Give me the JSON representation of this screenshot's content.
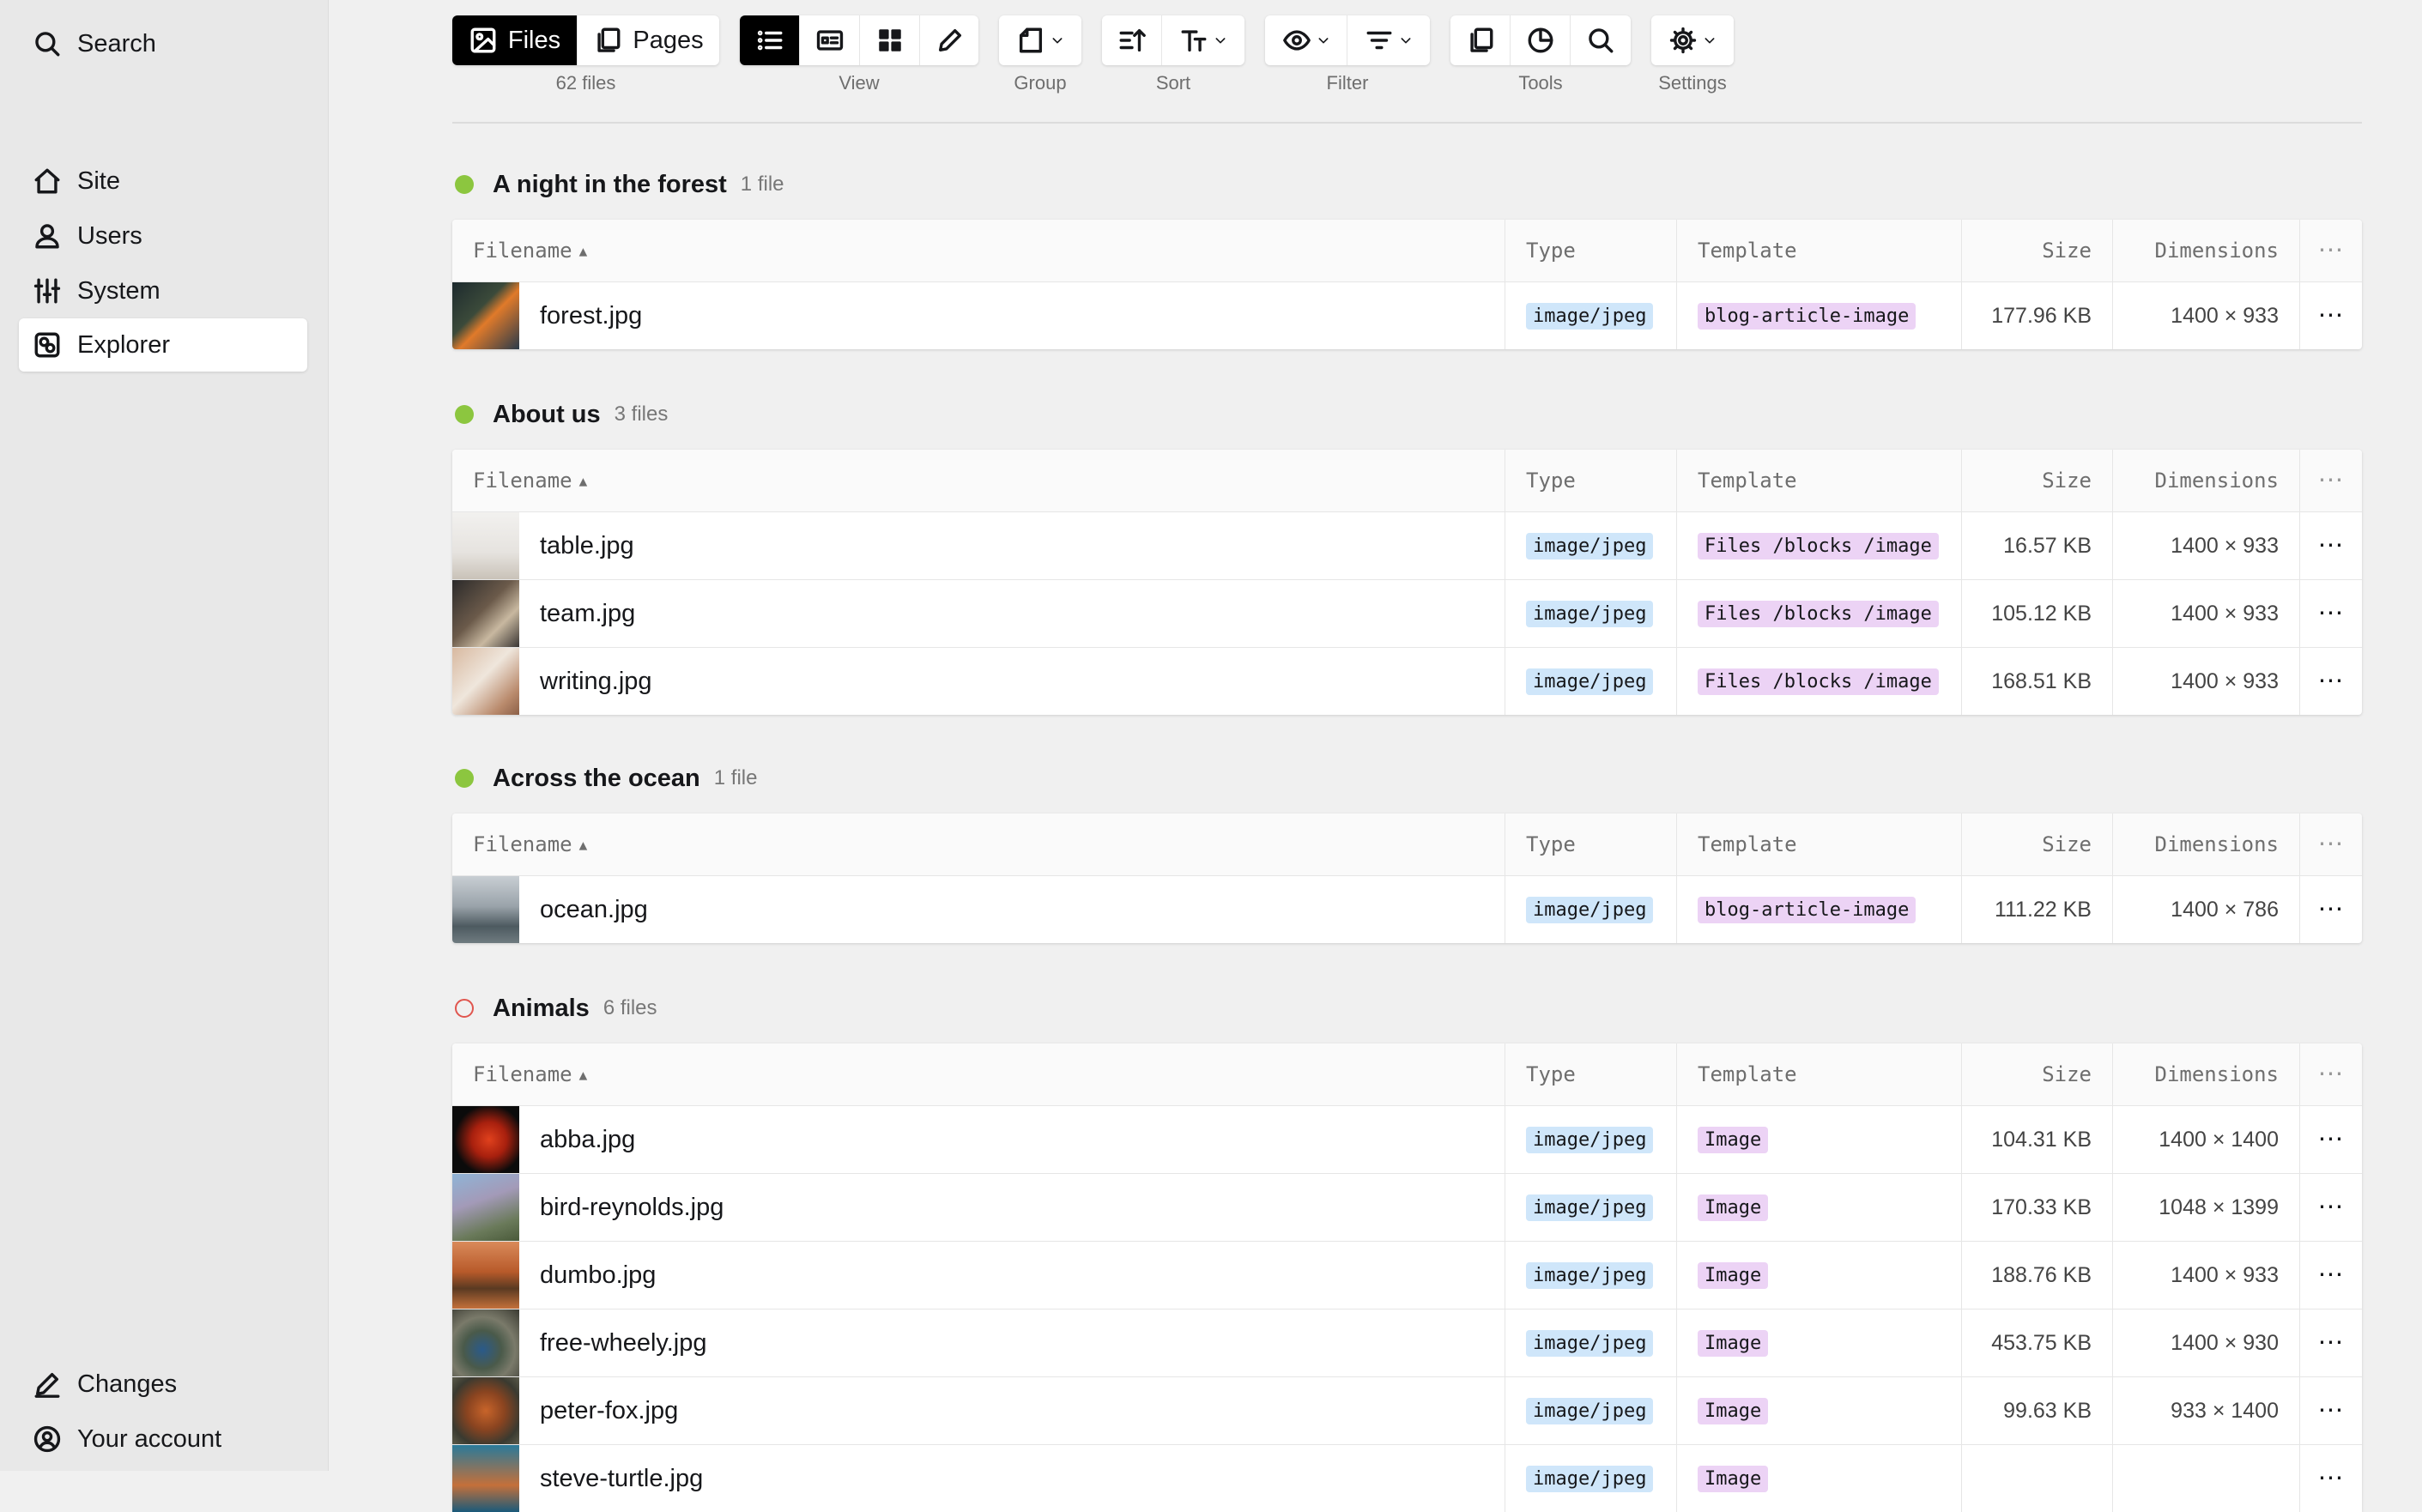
{
  "sidebar": {
    "search": {
      "label": "Search",
      "icon": "search-icon"
    },
    "items": [
      {
        "label": "Site",
        "icon": "home-icon"
      },
      {
        "label": "Users",
        "icon": "users-icon"
      },
      {
        "label": "System",
        "icon": "sliders-icon"
      },
      {
        "label": "Explorer",
        "icon": "explorer-icon",
        "active": true
      }
    ],
    "bottom": [
      {
        "label": "Changes",
        "icon": "pencil-icon"
      },
      {
        "label": "Your account",
        "icon": "account-icon"
      }
    ]
  },
  "toolbar": {
    "files_label": "Files",
    "pages_label": "Pages",
    "files_caption": "62 files",
    "view_caption": "View",
    "group_caption": "Group",
    "sort_caption": "Sort",
    "filter_caption": "Filter",
    "tools_caption": "Tools",
    "settings_caption": "Settings"
  },
  "columns": {
    "filename": "Filename",
    "type": "Type",
    "template": "Template",
    "size": "Size",
    "dimensions": "Dimensions",
    "options": "⋯"
  },
  "sections": [
    {
      "title": "A night in the forest",
      "count": "1 file",
      "status": "green",
      "files": [
        {
          "name": "forest.jpg",
          "type": "image/jpeg",
          "template": "blog-article-image",
          "size": "177.96 KB",
          "dimensions": "1400 × 933"
        }
      ]
    },
    {
      "title": "About us",
      "count": "3 files",
      "status": "green",
      "files": [
        {
          "name": "table.jpg",
          "type": "image/jpeg",
          "template": "Files /blocks /image",
          "size": "16.57 KB",
          "dimensions": "1400 × 933"
        },
        {
          "name": "team.jpg",
          "type": "image/jpeg",
          "template": "Files /blocks /image",
          "size": "105.12 KB",
          "dimensions": "1400 × 933"
        },
        {
          "name": "writing.jpg",
          "type": "image/jpeg",
          "template": "Files /blocks /image",
          "size": "168.51 KB",
          "dimensions": "1400 × 933"
        }
      ]
    },
    {
      "title": "Across the ocean",
      "count": "1 file",
      "status": "green",
      "files": [
        {
          "name": "ocean.jpg",
          "type": "image/jpeg",
          "template": "blog-article-image",
          "size": "111.22 KB",
          "dimensions": "1400 × 786"
        }
      ]
    },
    {
      "title": "Animals",
      "count": "6 files",
      "status": "red",
      "files": [
        {
          "name": "abba.jpg",
          "type": "image/jpeg",
          "template": "Image",
          "size": "104.31 KB",
          "dimensions": "1400 × 1400"
        },
        {
          "name": "bird-reynolds.jpg",
          "type": "image/jpeg",
          "template": "Image",
          "size": "170.33 KB",
          "dimensions": "1048 × 1399"
        },
        {
          "name": "dumbo.jpg",
          "type": "image/jpeg",
          "template": "Image",
          "size": "188.76 KB",
          "dimensions": "1400 × 933"
        },
        {
          "name": "free-wheely.jpg",
          "type": "image/jpeg",
          "template": "Image",
          "size": "453.75 KB",
          "dimensions": "1400 × 930"
        },
        {
          "name": "peter-fox.jpg",
          "type": "image/jpeg",
          "template": "Image",
          "size": "99.63 KB",
          "dimensions": "933 × 1400"
        },
        {
          "name": "steve-turtle.jpg",
          "type": "image/jpeg",
          "template": "Image",
          "size": "",
          "dimensions": ""
        }
      ]
    }
  ],
  "colors": {
    "status_green": "#8cc63f",
    "status_red": "#e0554e",
    "type_badge": "#cfe6fa",
    "template_badge": "#ecd3f5",
    "active_button": "#000000"
  }
}
